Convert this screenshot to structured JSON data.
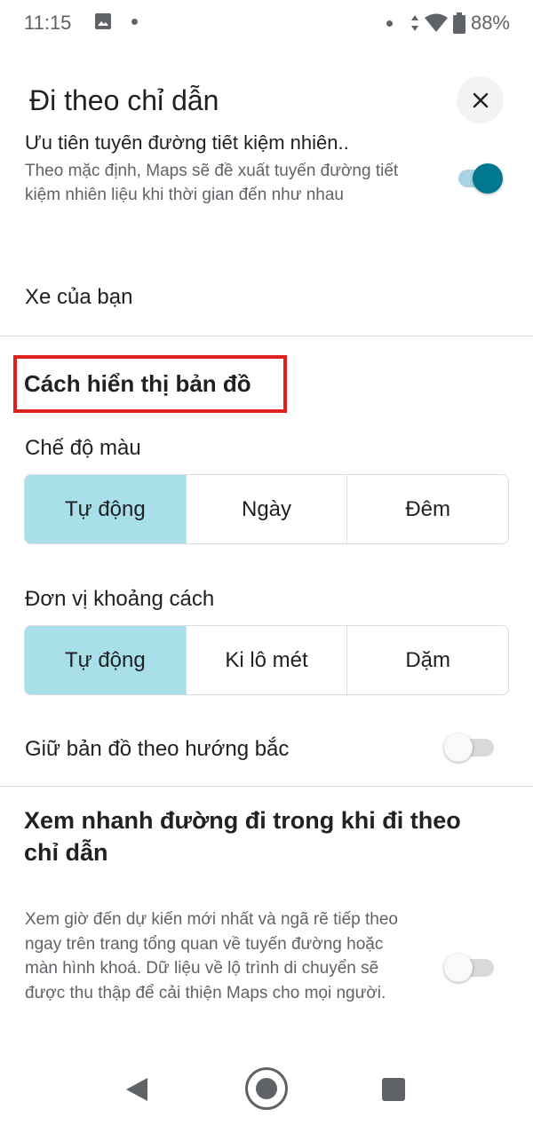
{
  "status_bar": {
    "time": "11:15",
    "battery": "88%"
  },
  "header": {
    "title": "Đi theo chỉ dẫn",
    "close_icon": "close-icon"
  },
  "fuel_setting": {
    "title_partial": "Ưu tiên tuyến đường tiết kiệm nhiên..",
    "description": "Theo mặc định, Maps sẽ đề xuất tuyến đường tiết kiệm nhiên liệu khi thời gian đến như nhau",
    "enabled": true
  },
  "your_vehicle": {
    "label": "Xe của bạn"
  },
  "map_display": {
    "heading": "Cách hiển thị bản đồ",
    "color_mode": {
      "label": "Chế độ màu",
      "options": [
        "Tự động",
        "Ngày",
        "Đêm"
      ],
      "selected": "Tự động"
    },
    "distance_units": {
      "label": "Đơn vị khoảng cách",
      "options": [
        "Tự động",
        "Ki lô mét",
        "Dặm"
      ],
      "selected": "Tự động"
    },
    "keep_north_up": {
      "label": "Giữ bản đồ theo hướng bắc",
      "enabled": false
    }
  },
  "glanceable": {
    "heading": "Xem nhanh đường đi trong khi đi theo chỉ dẫn",
    "description": "Xem giờ đến dự kiến mới nhất và ngã rẽ tiếp theo ngay trên trang tổng quan về tuyến đường hoặc màn hình khoá. Dữ liệu về lộ trình di chuyển sẽ được thu thập để cải thiện Maps cho mọi người.",
    "enabled": false
  },
  "colors": {
    "accent": "#00788f",
    "selected_segment": "#a8dfe8",
    "highlight_border": "#e0201c"
  }
}
